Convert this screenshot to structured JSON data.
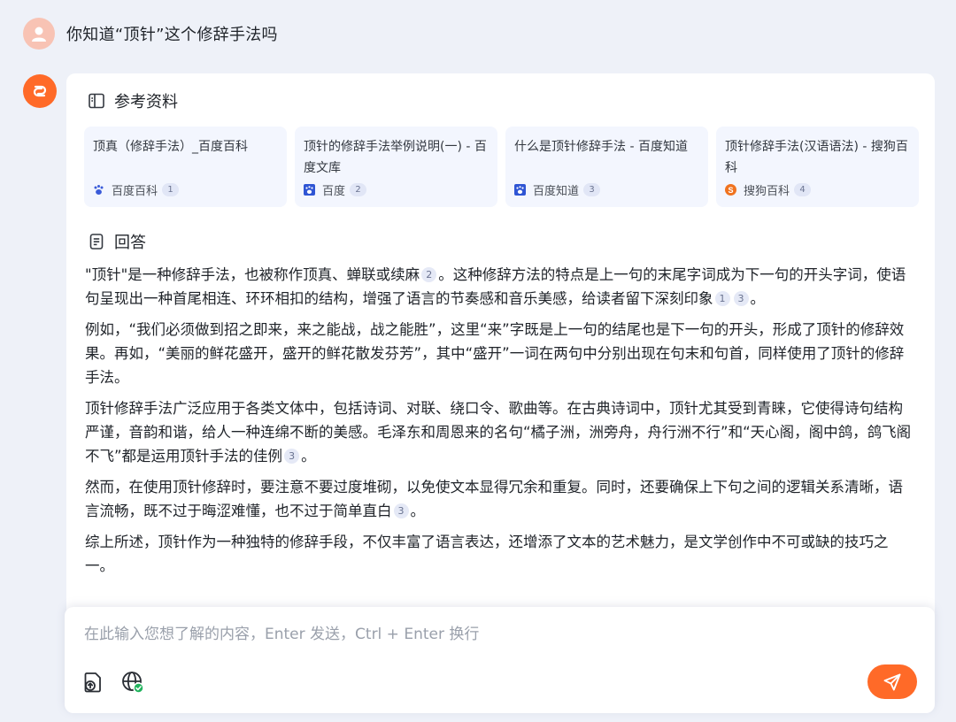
{
  "conversation": {
    "question": "你知道“顶针”这个修辞手法吗"
  },
  "references": {
    "heading": "参考资料",
    "items": [
      {
        "title": "顶真（修辞手法）_百度百科",
        "source": "百度百科",
        "index": "1",
        "icon": "baidu-paw-icon"
      },
      {
        "title": "顶针的修辞手法举例说明(一) - 百度文库",
        "source": "百度",
        "index": "2",
        "icon": "baidu-paw-icon"
      },
      {
        "title": "什么是顶针修辞手法 - 百度知道",
        "source": "百度知道",
        "index": "3",
        "icon": "baidu-paw-icon"
      },
      {
        "title": "顶针修辞手法(汉语语法) - 搜狗百科",
        "source": "搜狗百科",
        "index": "4",
        "icon": "sogou-icon"
      }
    ]
  },
  "answer": {
    "heading": "回答",
    "p1": {
      "a": "\"顶针\"是一种修辞手法，也被称作顶真、蝉联或续麻",
      "c1": "2",
      "b": "。这种修辞方法的特点是上一句的末尾字词成为下一句的开头字词，使语句呈现出一种首尾相连、环环相扣的结构，增强了语言的节奏感和音乐美感，给读者留下深刻印象",
      "c2": "1",
      "c3": "3",
      "c": "。"
    },
    "p2": "例如，“我们必须做到招之即来，来之能战，战之能胜”，这里“来”字既是上一句的结尾也是下一句的开头，形成了顶针的修辞效果。再如，“美丽的鲜花盛开，盛开的鲜花散发芬芳”，其中“盛开”一词在两句中分别出现在句末和句首，同样使用了顶针的修辞手法。",
    "p3": {
      "a": "顶针修辞手法广泛应用于各类文体中，包括诗词、对联、绕口令、歌曲等。在古典诗词中，顶针尤其受到青睐，它使得诗句结构严谨，音韵和谐，给人一种连绵不断的美感。毛泽东和周恩来的名句“橘子洲，洲旁舟，舟行洲不行”和“天心阁，阁中鸽，鸽飞阁不飞”都是运用顶针手法的佳例",
      "c1": "3",
      "b": "。"
    },
    "p4": {
      "a": "然而，在使用顶针修辞时，要注意不要过度堆砌，以免使文本显得冗余和重复。同时，还要确保上下句之间的逻辑关系清晰，语言流畅，既不过于晦涩难懂，也不过于简单直白",
      "c1": "3",
      "b": "。"
    },
    "p5": "综上所述，顶针作为一种独特的修辞手段，不仅丰富了语言表达，还增添了文本的艺术魅力，是文学创作中不可或缺的技巧之一。"
  },
  "input": {
    "placeholder": "在此输入您想了解的内容，Enter 发送，Ctrl + Enter 换行"
  },
  "colors": {
    "accent": "#ff6a28",
    "card_bg": "#f3f6fe",
    "page_bg": "#eef1f8"
  }
}
